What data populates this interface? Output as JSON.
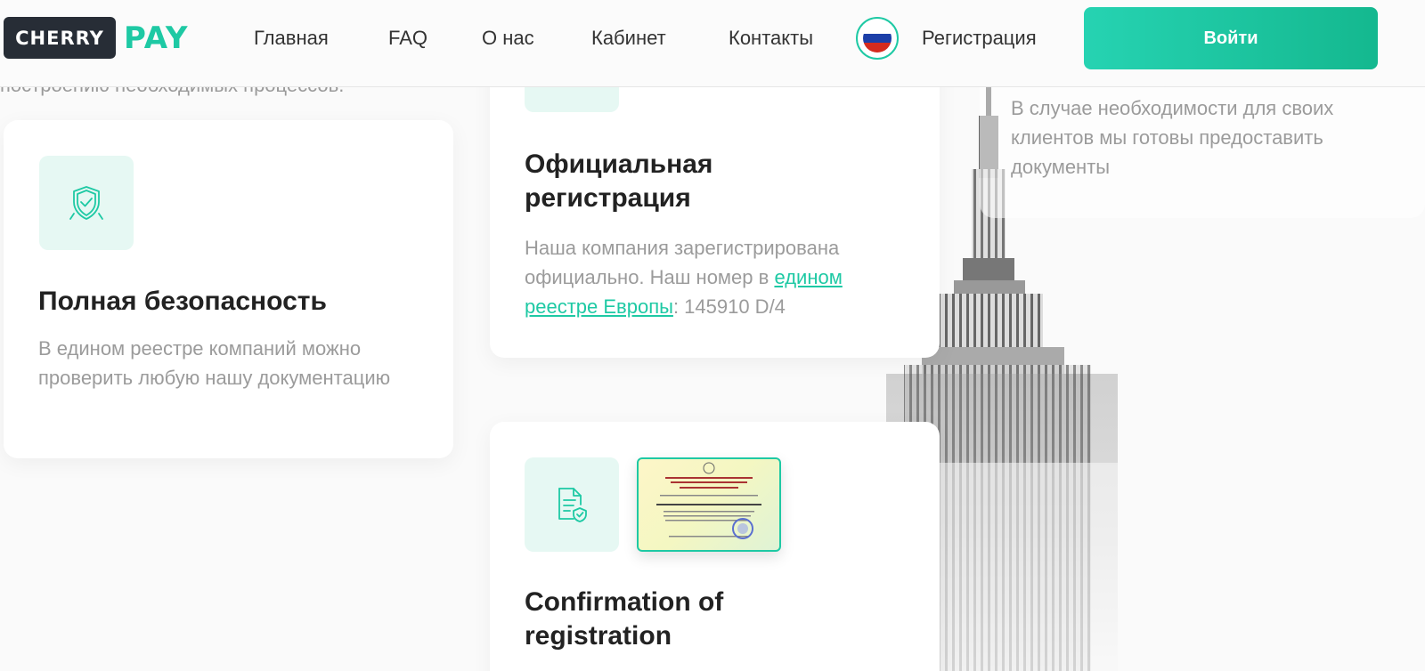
{
  "header": {
    "logo_cherry": "CHERRY",
    "logo_pay": "PAY",
    "nav": [
      "Главная",
      "FAQ",
      "О нас",
      "Кабинет",
      "Контакты"
    ],
    "register": "Регистрация",
    "login": "Войти"
  },
  "top_cut_text": "построению необходимых процессов.",
  "cards": {
    "security": {
      "title": "Полная безопасность",
      "text": "В едином реестре компаний можно проверить любую нашу документацию"
    },
    "official": {
      "title": "Официальная регистрация",
      "text_before": "Наша компания зарегистрирована официально. Наш номер в ",
      "link": "едином реестре Европы",
      "text_after": ": 145910 D/4"
    },
    "documents": {
      "text": "В случае необходимости для своих клиентов мы готовы предоставить документы"
    },
    "confirmation": {
      "title": "Confirmation of registration"
    }
  },
  "colors": {
    "accent": "#1ec9a4",
    "logo_dark": "#272d36",
    "icon_bg": "#e6f8f3",
    "text_muted": "#9b9b9b"
  },
  "icons": {
    "security": "shield-check-icon",
    "confirmation": "document-shield-icon",
    "language": "russian-flag-icon"
  }
}
